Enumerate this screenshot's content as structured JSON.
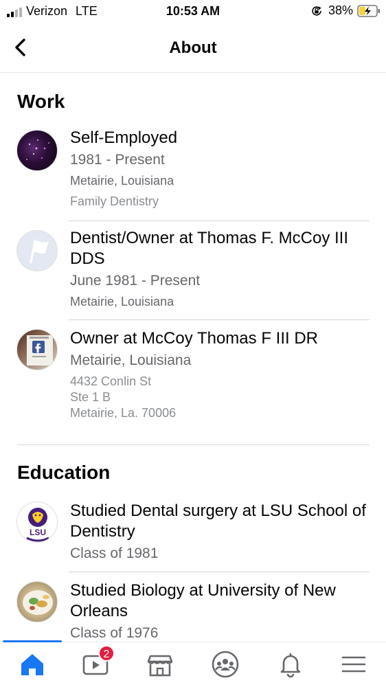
{
  "status_bar": {
    "carrier": "Verizon",
    "network": "LTE",
    "time": "10:53 AM",
    "battery_percent": "38%",
    "signal_bars_filled": 2,
    "signal_bars_total": 4,
    "battery_level": 0.38
  },
  "nav": {
    "title": "About",
    "back_icon": "chevron-left-icon"
  },
  "work": {
    "heading": "Work",
    "items": [
      {
        "title": "Self-Employed",
        "dates": "1981 - Present",
        "location": "Metairie, Louisiana",
        "description": "Family Dentistry"
      },
      {
        "title_prefix": "Dentist/Owner at ",
        "title_org": "Thomas F. McCoy III DDS",
        "dates": "June 1981 - Present",
        "location": "Metairie, Louisiana"
      },
      {
        "title_prefix": "Owner at ",
        "title_org": "McCoy Thomas F III DR",
        "location": "Metairie, Louisiana",
        "address_1": "4432 Conlin St",
        "address_2": "Ste 1 B",
        "address_3": "Metairie, La. 70006"
      }
    ]
  },
  "education": {
    "heading": "Education",
    "items": [
      {
        "title": "Studied Dental surgery at LSU School of Dentistry",
        "class": "Class of 1981",
        "logo_text": "LSU"
      },
      {
        "title": "Studied Biology at University of New Orleans",
        "class": "Class of 1976"
      }
    ]
  },
  "tab_bar": {
    "active_tab": "home",
    "tabs": [
      {
        "name": "home",
        "icon": "home-icon"
      },
      {
        "name": "watch",
        "icon": "video-icon",
        "badge": "2"
      },
      {
        "name": "marketplace",
        "icon": "marketplace-icon"
      },
      {
        "name": "groups",
        "icon": "groups-icon"
      },
      {
        "name": "notifications",
        "icon": "bell-icon"
      },
      {
        "name": "menu",
        "icon": "menu-icon"
      }
    ],
    "colors": {
      "active": "#1877f2",
      "inactive": "#65676b",
      "badge": "#e41e3f"
    }
  }
}
